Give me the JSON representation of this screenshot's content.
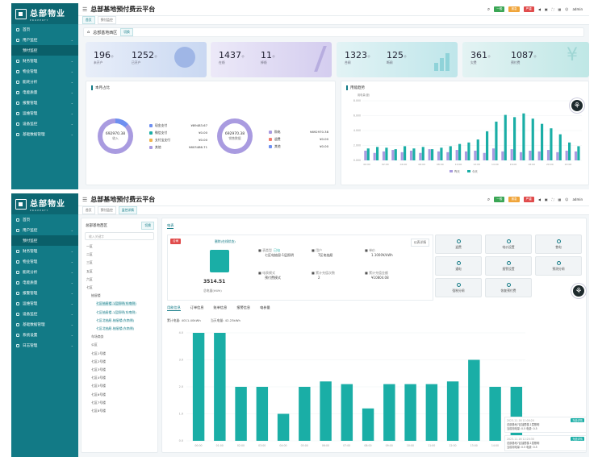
{
  "app": {
    "logo_text": "总部物业",
    "logo_sub": "PROPERTY",
    "title": "总部基地预付费云平台",
    "user": "admin",
    "badge1": "一般",
    "badge2": "紧急",
    "badge3": "严重"
  },
  "colors": {
    "teal": "#127a86",
    "dark": "#0d6772",
    "accent": "#1aaea6",
    "purple": "#a99be0"
  },
  "menu": [
    {
      "label": "首页",
      "icon": "home-icon"
    },
    {
      "label": "用户监控",
      "icon": "monitor-icon",
      "open": true
    },
    {
      "label": "预付监控",
      "sub": true
    },
    {
      "label": "财务管理",
      "icon": "finance-icon"
    },
    {
      "label": "物业管理",
      "icon": "property-icon"
    },
    {
      "label": "能耗分析",
      "icon": "analysis-icon"
    },
    {
      "label": "电能质量",
      "icon": "quality-icon"
    },
    {
      "label": "报警管理",
      "icon": "alarm-icon"
    },
    {
      "label": "运维管理",
      "icon": "ops-icon"
    },
    {
      "label": "设备监控",
      "icon": "device-icon"
    },
    {
      "label": "基础数据管理",
      "icon": "data-icon"
    },
    {
      "label": "系统设置",
      "icon": "settings-icon"
    },
    {
      "label": "日志管理",
      "icon": "log-icon"
    }
  ],
  "s1": {
    "tabs": [
      "首页",
      "预付监控"
    ],
    "breadcrumb": "总部基地西区",
    "bc_btn": "切换",
    "sub_tabs": [
      "电",
      "水"
    ],
    "stats": [
      {
        "v1": "196",
        "u1": "个",
        "l1": "未开户",
        "v2": "1252",
        "u2": "个",
        "l2": "已开户"
      },
      {
        "v1": "1437",
        "u1": "个",
        "l1": "在线",
        "v2": "11",
        "u2": "个",
        "l2": "掉线"
      },
      {
        "v1": "1323",
        "u1": "个",
        "l1": "合闸",
        "v2": "125",
        "u2": "个",
        "l2": "断闸"
      },
      {
        "v1": "361",
        "u1": "个",
        "l1": "欠费",
        "v2": "1087",
        "u2": "个",
        "l2": "预付费"
      }
    ],
    "pay_title": "本月占比",
    "donut1": {
      "value": "692970.38",
      "label": "收入"
    },
    "legend1": [
      {
        "name": "现金支付",
        "v": "¥89483.67",
        "c": "#6e8ff0"
      },
      {
        "name": "微信支付",
        "v": "¥0.00",
        "c": "#1aaea6"
      },
      {
        "name": "支付宝支付",
        "v": "¥0.00",
        "c": "#f0b44e"
      },
      {
        "name": "其他",
        "v": "¥603486.71",
        "c": "#a99be0"
      }
    ],
    "donut2": {
      "value": "692970.38",
      "label": "销售数据"
    },
    "legend2": [
      {
        "name": "购电",
        "v": "¥692970.38",
        "c": "#a99be0"
      },
      {
        "name": "退费",
        "v": "¥0.00",
        "c": "#f07b6e"
      },
      {
        "name": "其他",
        "v": "¥0.00",
        "c": "#6e8ff0"
      }
    ],
    "chart_title": "用能趋势",
    "yunit": "用电量(度)"
  },
  "s2": {
    "tabs": [
      "首页",
      "预付监控",
      "监控详情"
    ],
    "region": "总部基地西区",
    "region_btn": "切换",
    "search_ph": "输入关键字",
    "tree": [
      "一区",
      "二区",
      "三区",
      "五区",
      "六区",
      "七区",
      "抽屉楼",
      "七区抽屉楼-1层照明(东南侧)",
      "七区抽屉楼-1层照明(东南侧)",
      "七区北抽屉-抽屉楼(东南侧)",
      "七区北抽屉-抽屉楼(东南侧)",
      "车场商务",
      "公区",
      "七区1号楼",
      "七区2号楼",
      "七区3号楼",
      "七区4号楼",
      "七区5号楼",
      "七区6号楼",
      "七区7号楼",
      "七区8号楼"
    ],
    "device_tab": "电表",
    "status": "合闸",
    "conn": "删除(在线状态)",
    "meter_value": "3514.51",
    "meter_label": "总电量(kWh)",
    "detail_btn": "仪表详情",
    "info": [
      {
        "l": "表类型",
        "v": "七区电抽屉-1层照明",
        "tag": "已勾"
      },
      {
        "l": "用户",
        "v": "7区电抽屉"
      },
      {
        "l": "单价",
        "v": "1.1000¥/kWh"
      },
      {
        "l": "电表模式",
        "v": "预付费模式"
      },
      {
        "l": "累计充值次数",
        "v": "2"
      },
      {
        "l": "累计充值金额",
        "v": "¥10804.08"
      }
    ],
    "actions": [
      "退费",
      "电价设置",
      "售电",
      "通电",
      "报警设置",
      "预测分闸",
      "强制分闸",
      "恢复预付费"
    ],
    "detail_tabs": [
      "用能信息",
      "订单信息",
      "账单信息",
      "报警信息",
      "电参量"
    ],
    "usage_label1": "累计电量: 4011.40kWh",
    "usage_label2": "当天电量: 42.23kWh",
    "notes": [
      {
        "t": "2023-11-16 11:00:20",
        "btn": "充值详情",
        "lines": [
          "总部基地7区抽屉楼-1层照明",
          "当前用电量: 0.5 电费: 0.5"
        ]
      },
      {
        "t": "2023-11-16 12:20:30",
        "btn": "充值详情",
        "lines": [
          "总部基地7区抽屉楼-1层照明",
          "当前用电量: 0.5 电费: 0.5"
        ]
      }
    ]
  },
  "chart_data": [
    {
      "type": "bar",
      "title": "用能趋势",
      "ylabel": "用电量(度)",
      "categories": [
        "00:00",
        "01:00",
        "02:00",
        "03:00",
        "04:00",
        "05:00",
        "06:00",
        "07:00",
        "08:00",
        "09:00",
        "10:00",
        "11:00",
        "12:00",
        "13:00",
        "14:00",
        "15:00",
        "16:00",
        "17:00",
        "18:00",
        "19:00",
        "20:00",
        "21:00",
        "22:00",
        "23:00"
      ],
      "series": [
        {
          "name": "昨天",
          "values": [
            1.3,
            1.0,
            1.2,
            1.4,
            1.1,
            1.3,
            1.0,
            1.5,
            1.2,
            1.1,
            1.4,
            1.2,
            1.3,
            1.0,
            1.6,
            1.2,
            1.5,
            1.1,
            1.3,
            1.2,
            1.4,
            1.1,
            1.3,
            1.2
          ]
        },
        {
          "name": "今天",
          "values": [
            1.6,
            1.8,
            1.7,
            1.5,
            1.9,
            1.6,
            1.8,
            1.5,
            1.7,
            1.9,
            2.2,
            2.4,
            2.8,
            3.9,
            5.2,
            6.1,
            5.8,
            6.3,
            5.6,
            4.9,
            4.3,
            3.5,
            2.4,
            1.9
          ]
        }
      ],
      "ylim": [
        0,
        8
      ]
    },
    {
      "type": "bar",
      "title": "用能信息",
      "categories": [
        "00:00",
        "01:00",
        "02:00",
        "03:00",
        "04:00",
        "05:00",
        "06:00",
        "07:00",
        "08:00",
        "09:00",
        "10:00",
        "11:00",
        "12:00",
        "13:00",
        "14:00",
        "15:00"
      ],
      "values": [
        4.0,
        4.0,
        2.0,
        2.0,
        1.0,
        2.0,
        2.2,
        2.1,
        1.2,
        2.1,
        2.1,
        2.1,
        2.2,
        3.0,
        2.0,
        2.0
      ],
      "ylim": [
        0,
        4
      ]
    }
  ]
}
